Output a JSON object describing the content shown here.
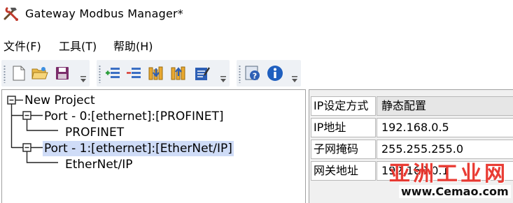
{
  "window": {
    "title": "Gateway Modbus Manager*",
    "icon": "hammer-wrench-icon"
  },
  "menu": {
    "items": [
      {
        "label": "文件(F)"
      },
      {
        "label": "工具(T)"
      },
      {
        "label": "帮助(H)"
      }
    ]
  },
  "toolbar": {
    "groups": [
      {
        "icons": [
          "new-file-icon",
          "open-folder-icon",
          "save-icon"
        ]
      },
      {
        "icons": [
          "add-slave-icon",
          "remove-slave-icon",
          "download-config-icon",
          "upload-config-icon",
          "edit-config-icon"
        ]
      },
      {
        "icons": [
          "help-icon",
          "info-icon"
        ]
      }
    ]
  },
  "tree": {
    "root": {
      "label": "New Project",
      "children": [
        {
          "label": "Port - 0:[ethernet]:[PROFINET]",
          "children": [
            {
              "label": "PROFINET"
            }
          ]
        },
        {
          "label": "Port - 1:[ethernet]:[EtherNet/IP]",
          "selected": true,
          "children": [
            {
              "label": "EtherNet/IP"
            }
          ]
        }
      ]
    }
  },
  "properties": {
    "rows": [
      {
        "key": "IP设定方式",
        "value": "静态配置"
      },
      {
        "key": "IP地址",
        "value": "192.168.0.5"
      },
      {
        "key": "子网掩码",
        "value": "255.255.255.0"
      },
      {
        "key": "网关地址",
        "value": "192.168.0.1"
      }
    ]
  },
  "watermark": {
    "logo_text": "亚洲工业网",
    "url": "www.Cemao.com"
  },
  "colors": {
    "selection": "#cfdcf7",
    "toolbar_bg": "#eef1f5",
    "watermark_red": "#e8322a"
  }
}
